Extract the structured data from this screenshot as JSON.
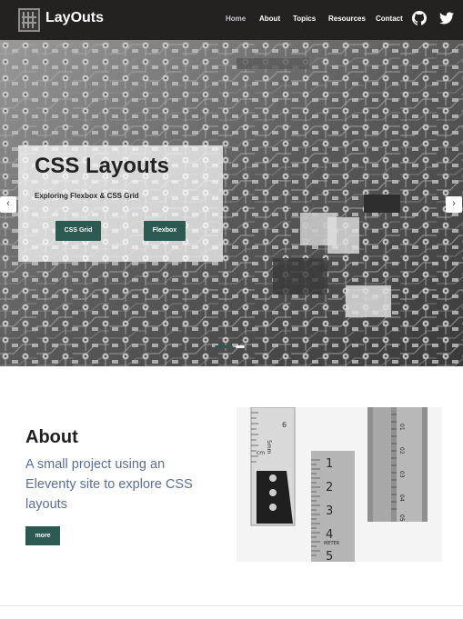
{
  "header": {
    "brand": "LayOuts",
    "nav": [
      {
        "label": "Home",
        "active": true
      },
      {
        "label": "About"
      },
      {
        "label": "Topics"
      },
      {
        "label": "Resources"
      },
      {
        "label": "Contact"
      }
    ],
    "icons": [
      "github-icon",
      "twitter-icon"
    ]
  },
  "hero": {
    "title": "CSS Layouts",
    "subtitle": "Exploring Flexbox & CSS Grid",
    "buttons": [
      {
        "label": "CSS Grid"
      },
      {
        "label": "Flexbox"
      }
    ],
    "prev_glyph": "‹",
    "next_glyph": "›",
    "slides": 2,
    "active_slide": 1
  },
  "about": {
    "title": "About",
    "text": "A small project using an Eleventy site to explore CSS layouts",
    "button": "more",
    "image_ruler_text": [
      "5mm",
      "6",
      "cm",
      "1",
      "2",
      "3",
      "4",
      "METER",
      "5",
      "01",
      "02",
      "03",
      "04",
      "05"
    ]
  },
  "colors": {
    "header_bg": "#242121",
    "accent": "#2c5952",
    "about_text": "#5c6f92",
    "nav_active": "#c9ccd4"
  }
}
